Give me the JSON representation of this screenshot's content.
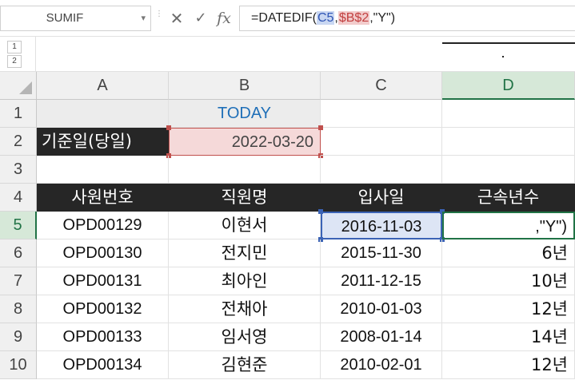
{
  "name_box": {
    "value": "SUMIF"
  },
  "formula_bar": {
    "prefix": "=DATEDIF(",
    "ref1": "C5",
    "sep1": ",",
    "ref2": "$B$2",
    "suffix": ",\"Y\")"
  },
  "outline_levels": [
    "1",
    "2"
  ],
  "columns": [
    "A",
    "B",
    "C",
    "D"
  ],
  "rows": [
    "1",
    "2",
    "3",
    "4",
    "5",
    "6",
    "7",
    "8",
    "9",
    "10"
  ],
  "cells": {
    "B1": "TODAY",
    "A2": "기준일(당일)",
    "B2": "2022-03-20",
    "A4": "사원번호",
    "B4": "직원명",
    "C4": "입사일",
    "D4": "근속년수",
    "D5": ",\"Y\")",
    "data": [
      {
        "id": "OPD00129",
        "name": "이현서",
        "date": "2016-11-03",
        "years": ""
      },
      {
        "id": "OPD00130",
        "name": "전지민",
        "date": "2015-11-30",
        "years": "6년"
      },
      {
        "id": "OPD00131",
        "name": "최아인",
        "date": "2011-12-15",
        "years": "10년"
      },
      {
        "id": "OPD00132",
        "name": "전채아",
        "date": "2010-01-03",
        "years": "12년"
      },
      {
        "id": "OPD00133",
        "name": "임서영",
        "date": "2008-01-14",
        "years": "14년"
      },
      {
        "id": "OPD00134",
        "name": "김현준",
        "date": "2010-02-01",
        "years": "12년"
      }
    ]
  },
  "colors": {
    "accent_green": "#217346",
    "ref_blue": "#3b63b5",
    "ref_red": "#c0504d",
    "header_dark": "#262626",
    "today_blue": "#1f6fb8"
  }
}
